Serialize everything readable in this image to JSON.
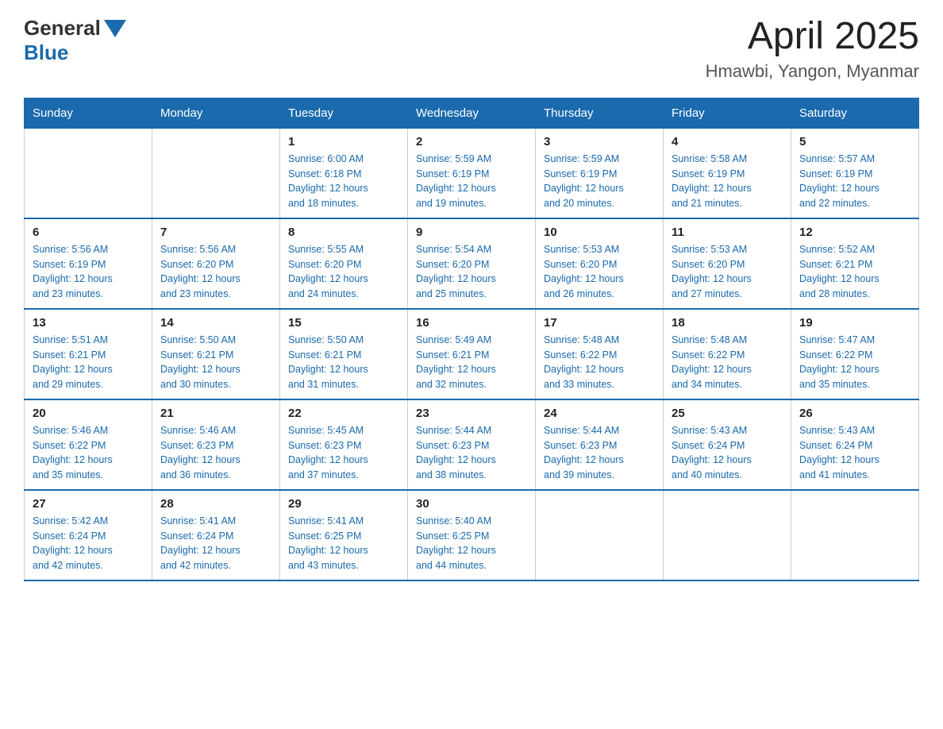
{
  "header": {
    "logo_general": "General",
    "logo_blue": "Blue",
    "month_title": "April 2025",
    "location": "Hmawbi, Yangon, Myanmar"
  },
  "calendar": {
    "days_of_week": [
      "Sunday",
      "Monday",
      "Tuesday",
      "Wednesday",
      "Thursday",
      "Friday",
      "Saturday"
    ],
    "weeks": [
      [
        {
          "day": "",
          "info": ""
        },
        {
          "day": "",
          "info": ""
        },
        {
          "day": "1",
          "info": "Sunrise: 6:00 AM\nSunset: 6:18 PM\nDaylight: 12 hours\nand 18 minutes."
        },
        {
          "day": "2",
          "info": "Sunrise: 5:59 AM\nSunset: 6:19 PM\nDaylight: 12 hours\nand 19 minutes."
        },
        {
          "day": "3",
          "info": "Sunrise: 5:59 AM\nSunset: 6:19 PM\nDaylight: 12 hours\nand 20 minutes."
        },
        {
          "day": "4",
          "info": "Sunrise: 5:58 AM\nSunset: 6:19 PM\nDaylight: 12 hours\nand 21 minutes."
        },
        {
          "day": "5",
          "info": "Sunrise: 5:57 AM\nSunset: 6:19 PM\nDaylight: 12 hours\nand 22 minutes."
        }
      ],
      [
        {
          "day": "6",
          "info": "Sunrise: 5:56 AM\nSunset: 6:19 PM\nDaylight: 12 hours\nand 23 minutes."
        },
        {
          "day": "7",
          "info": "Sunrise: 5:56 AM\nSunset: 6:20 PM\nDaylight: 12 hours\nand 23 minutes."
        },
        {
          "day": "8",
          "info": "Sunrise: 5:55 AM\nSunset: 6:20 PM\nDaylight: 12 hours\nand 24 minutes."
        },
        {
          "day": "9",
          "info": "Sunrise: 5:54 AM\nSunset: 6:20 PM\nDaylight: 12 hours\nand 25 minutes."
        },
        {
          "day": "10",
          "info": "Sunrise: 5:53 AM\nSunset: 6:20 PM\nDaylight: 12 hours\nand 26 minutes."
        },
        {
          "day": "11",
          "info": "Sunrise: 5:53 AM\nSunset: 6:20 PM\nDaylight: 12 hours\nand 27 minutes."
        },
        {
          "day": "12",
          "info": "Sunrise: 5:52 AM\nSunset: 6:21 PM\nDaylight: 12 hours\nand 28 minutes."
        }
      ],
      [
        {
          "day": "13",
          "info": "Sunrise: 5:51 AM\nSunset: 6:21 PM\nDaylight: 12 hours\nand 29 minutes."
        },
        {
          "day": "14",
          "info": "Sunrise: 5:50 AM\nSunset: 6:21 PM\nDaylight: 12 hours\nand 30 minutes."
        },
        {
          "day": "15",
          "info": "Sunrise: 5:50 AM\nSunset: 6:21 PM\nDaylight: 12 hours\nand 31 minutes."
        },
        {
          "day": "16",
          "info": "Sunrise: 5:49 AM\nSunset: 6:21 PM\nDaylight: 12 hours\nand 32 minutes."
        },
        {
          "day": "17",
          "info": "Sunrise: 5:48 AM\nSunset: 6:22 PM\nDaylight: 12 hours\nand 33 minutes."
        },
        {
          "day": "18",
          "info": "Sunrise: 5:48 AM\nSunset: 6:22 PM\nDaylight: 12 hours\nand 34 minutes."
        },
        {
          "day": "19",
          "info": "Sunrise: 5:47 AM\nSunset: 6:22 PM\nDaylight: 12 hours\nand 35 minutes."
        }
      ],
      [
        {
          "day": "20",
          "info": "Sunrise: 5:46 AM\nSunset: 6:22 PM\nDaylight: 12 hours\nand 35 minutes."
        },
        {
          "day": "21",
          "info": "Sunrise: 5:46 AM\nSunset: 6:23 PM\nDaylight: 12 hours\nand 36 minutes."
        },
        {
          "day": "22",
          "info": "Sunrise: 5:45 AM\nSunset: 6:23 PM\nDaylight: 12 hours\nand 37 minutes."
        },
        {
          "day": "23",
          "info": "Sunrise: 5:44 AM\nSunset: 6:23 PM\nDaylight: 12 hours\nand 38 minutes."
        },
        {
          "day": "24",
          "info": "Sunrise: 5:44 AM\nSunset: 6:23 PM\nDaylight: 12 hours\nand 39 minutes."
        },
        {
          "day": "25",
          "info": "Sunrise: 5:43 AM\nSunset: 6:24 PM\nDaylight: 12 hours\nand 40 minutes."
        },
        {
          "day": "26",
          "info": "Sunrise: 5:43 AM\nSunset: 6:24 PM\nDaylight: 12 hours\nand 41 minutes."
        }
      ],
      [
        {
          "day": "27",
          "info": "Sunrise: 5:42 AM\nSunset: 6:24 PM\nDaylight: 12 hours\nand 42 minutes."
        },
        {
          "day": "28",
          "info": "Sunrise: 5:41 AM\nSunset: 6:24 PM\nDaylight: 12 hours\nand 42 minutes."
        },
        {
          "day": "29",
          "info": "Sunrise: 5:41 AM\nSunset: 6:25 PM\nDaylight: 12 hours\nand 43 minutes."
        },
        {
          "day": "30",
          "info": "Sunrise: 5:40 AM\nSunset: 6:25 PM\nDaylight: 12 hours\nand 44 minutes."
        },
        {
          "day": "",
          "info": ""
        },
        {
          "day": "",
          "info": ""
        },
        {
          "day": "",
          "info": ""
        }
      ]
    ]
  }
}
